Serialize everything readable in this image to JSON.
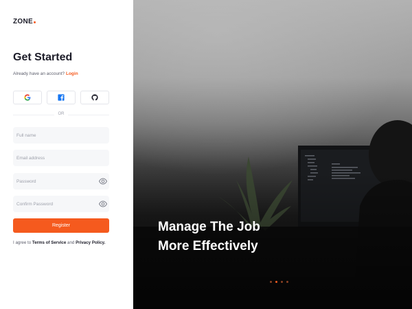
{
  "brand": {
    "name": "ZONE",
    "accent_color": "#f55a1e"
  },
  "form": {
    "title": "Get Started",
    "subtitle_prefix": "Already have an account?",
    "login_link": "Login",
    "social_buttons": [
      {
        "provider": "google",
        "icon": "google-icon"
      },
      {
        "provider": "facebook",
        "icon": "facebook-icon"
      },
      {
        "provider": "github",
        "icon": "github-icon"
      }
    ],
    "divider_text": "OR",
    "fields": {
      "full_name": {
        "placeholder": "Full name",
        "value": ""
      },
      "email": {
        "placeholder": "Email address",
        "value": ""
      },
      "password": {
        "placeholder": "Password",
        "value": "",
        "icon": "eye-icon"
      },
      "confirm_password": {
        "placeholder": "Confirm Password",
        "value": "",
        "icon": "eye-icon"
      }
    },
    "register_label": "Register",
    "terms_prefix": "I agree to",
    "terms_link": "Terms of Service",
    "terms_and": "and",
    "privacy_link": "Privacy Policy."
  },
  "hero": {
    "headline_line1": "Manage The Job",
    "headline_line2": "More Effectively",
    "carousel": {
      "count": 4,
      "active_index": 1
    }
  }
}
